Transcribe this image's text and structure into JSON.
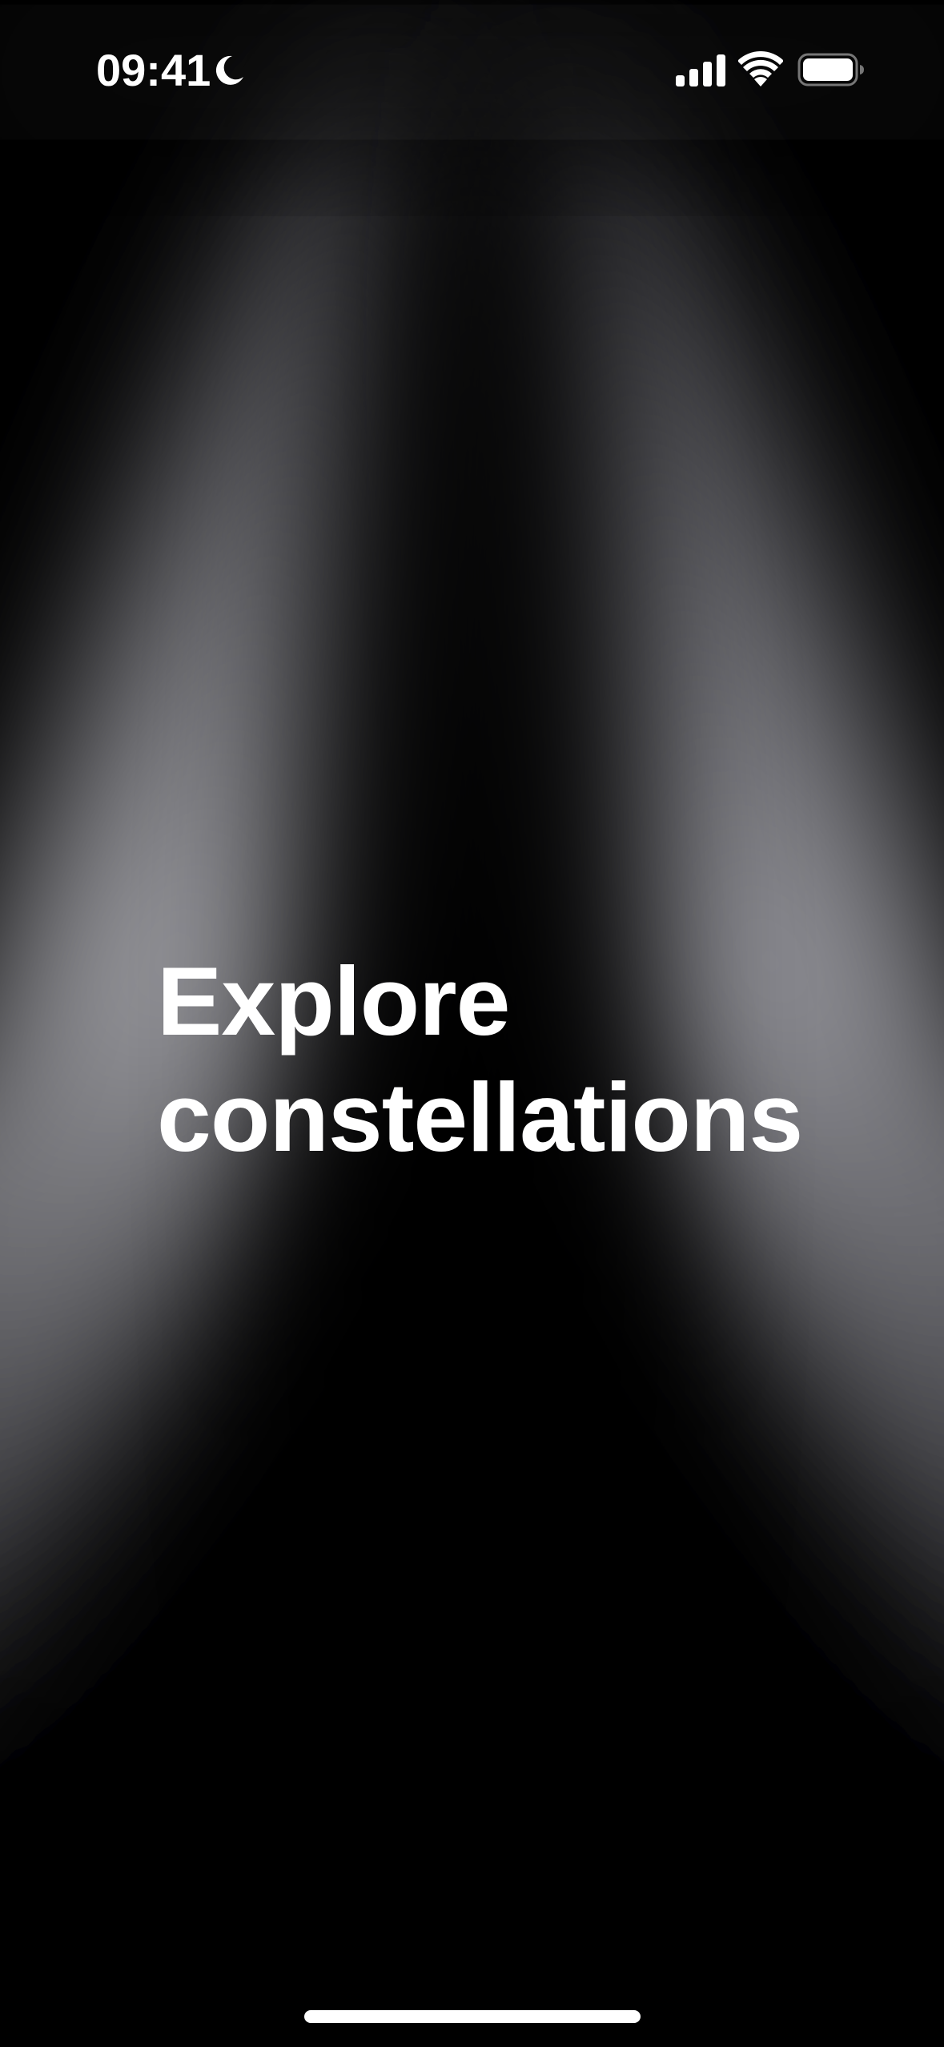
{
  "status_bar": {
    "time": "09:41",
    "focus_icon": "moon-icon",
    "signal_icon": "cellular-signal-icon",
    "wifi_icon": "wifi-icon",
    "battery_icon": "battery-icon"
  },
  "onboarding": {
    "headline_line1": "Explore",
    "headline_line2": "constellations"
  },
  "colors": {
    "background": "#000000",
    "glow": "#8e8e93",
    "text": "#ffffff"
  }
}
